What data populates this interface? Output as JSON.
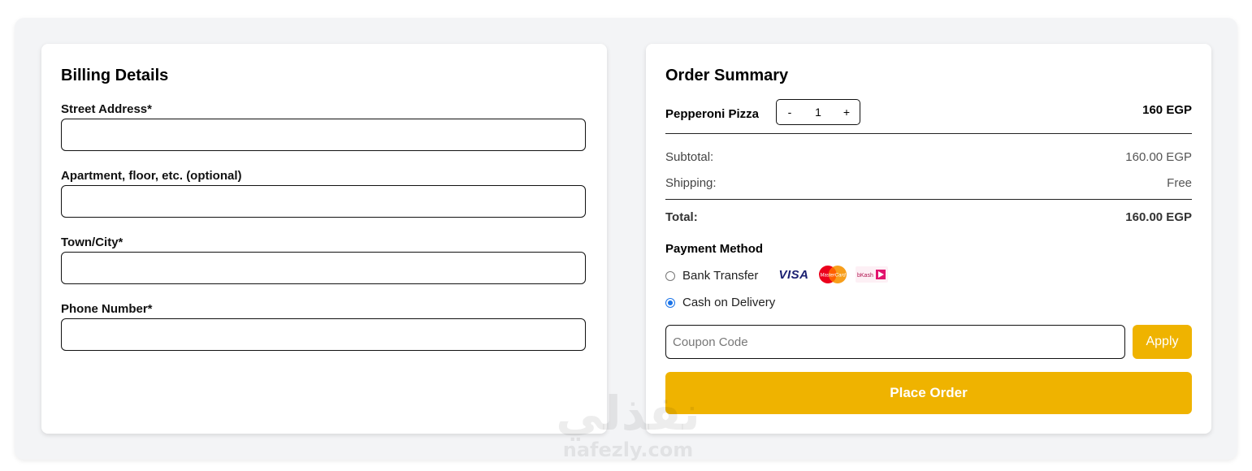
{
  "billing": {
    "title": "Billing Details",
    "fields": [
      {
        "label": "Street Address*",
        "value": ""
      },
      {
        "label": "Apartment, floor, etc. (optional)",
        "value": ""
      },
      {
        "label": "Town/City*",
        "value": ""
      },
      {
        "label": "Phone Number*",
        "value": ""
      }
    ]
  },
  "summary": {
    "title": "Order Summary",
    "item": {
      "name": "Pepperoni Pizza",
      "qty": "1",
      "minus": "-",
      "plus": "+",
      "price": "160 EGP"
    },
    "subtotal_label": "Subtotal:",
    "subtotal_value": "160.00 EGP",
    "shipping_label": "Shipping:",
    "shipping_value": "Free",
    "total_label": "Total:",
    "total_value": "160.00 EGP",
    "payment": {
      "title": "Payment Method",
      "options": [
        {
          "label": "Bank Transfer",
          "selected": false
        },
        {
          "label": "Cash on Delivery",
          "selected": true
        }
      ],
      "logos": [
        {
          "icon": "visa-logo-icon",
          "text": "VISA"
        },
        {
          "icon": "mastercard-logo-icon",
          "text": "MasterCard"
        },
        {
          "icon": "bkash-logo-icon",
          "text": "bKash"
        }
      ]
    },
    "coupon_placeholder": "Coupon Code",
    "apply_label": "Apply",
    "place_order_label": "Place Order"
  },
  "watermark": {
    "arabic": "نفذلي",
    "latin": "nafezly.com"
  },
  "colors": {
    "accent": "#efb300",
    "radio": "#1a73e8",
    "background": "#f3f4f6"
  }
}
